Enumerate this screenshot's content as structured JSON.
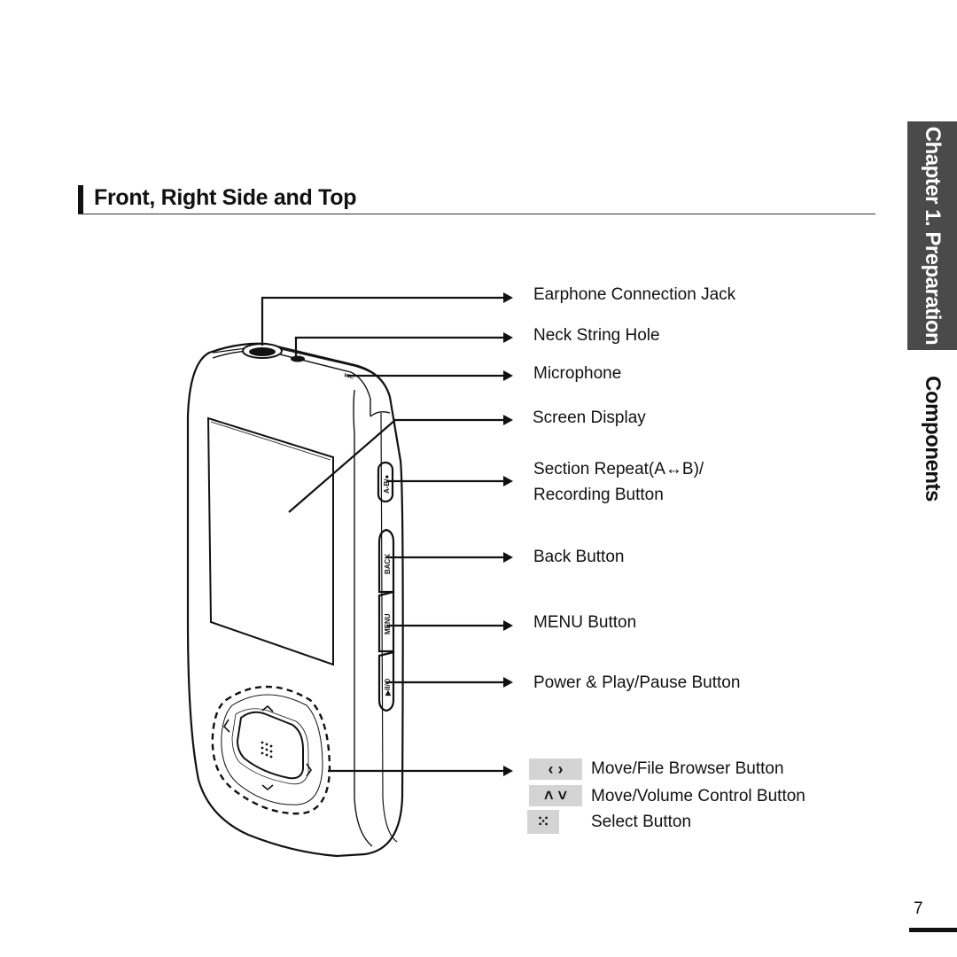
{
  "header": {
    "section_title": "Front, Right Side and Top"
  },
  "sidebar": {
    "chapter_tab": "Chapter 1. Preparation",
    "subsection": "Components"
  },
  "device_labels": {
    "side_buttons": [
      "A-B/●",
      "BACK",
      "MENU",
      "▶II/⏻"
    ],
    "mic_mark": "MIC"
  },
  "callouts": [
    {
      "id": "earphone-jack",
      "text": "Earphone Connection Jack"
    },
    {
      "id": "neck-string-hole",
      "text": "Neck String Hole"
    },
    {
      "id": "microphone",
      "text": "Microphone"
    },
    {
      "id": "screen-display",
      "text": "Screen Display"
    },
    {
      "id": "section-repeat",
      "text": "Section Repeat(A↔B)/",
      "text2": "Recording Button"
    },
    {
      "id": "back-button",
      "text": "Back Button"
    },
    {
      "id": "menu-button",
      "text": "MENU Button"
    },
    {
      "id": "power-play-pause",
      "text": "Power & Play/Pause Button"
    }
  ],
  "legend": [
    {
      "icon": "left-right-chevrons-icon",
      "glyph": "‹ ›",
      "text": "Move/File Browser Button"
    },
    {
      "icon": "up-down-chevrons-icon",
      "glyph": "˄ ˅",
      "text": "Move/Volume Control Button"
    },
    {
      "icon": "select-dots-icon",
      "glyph": "⁙",
      "text": "Select Button"
    }
  ],
  "footer": {
    "page_number": "7"
  }
}
